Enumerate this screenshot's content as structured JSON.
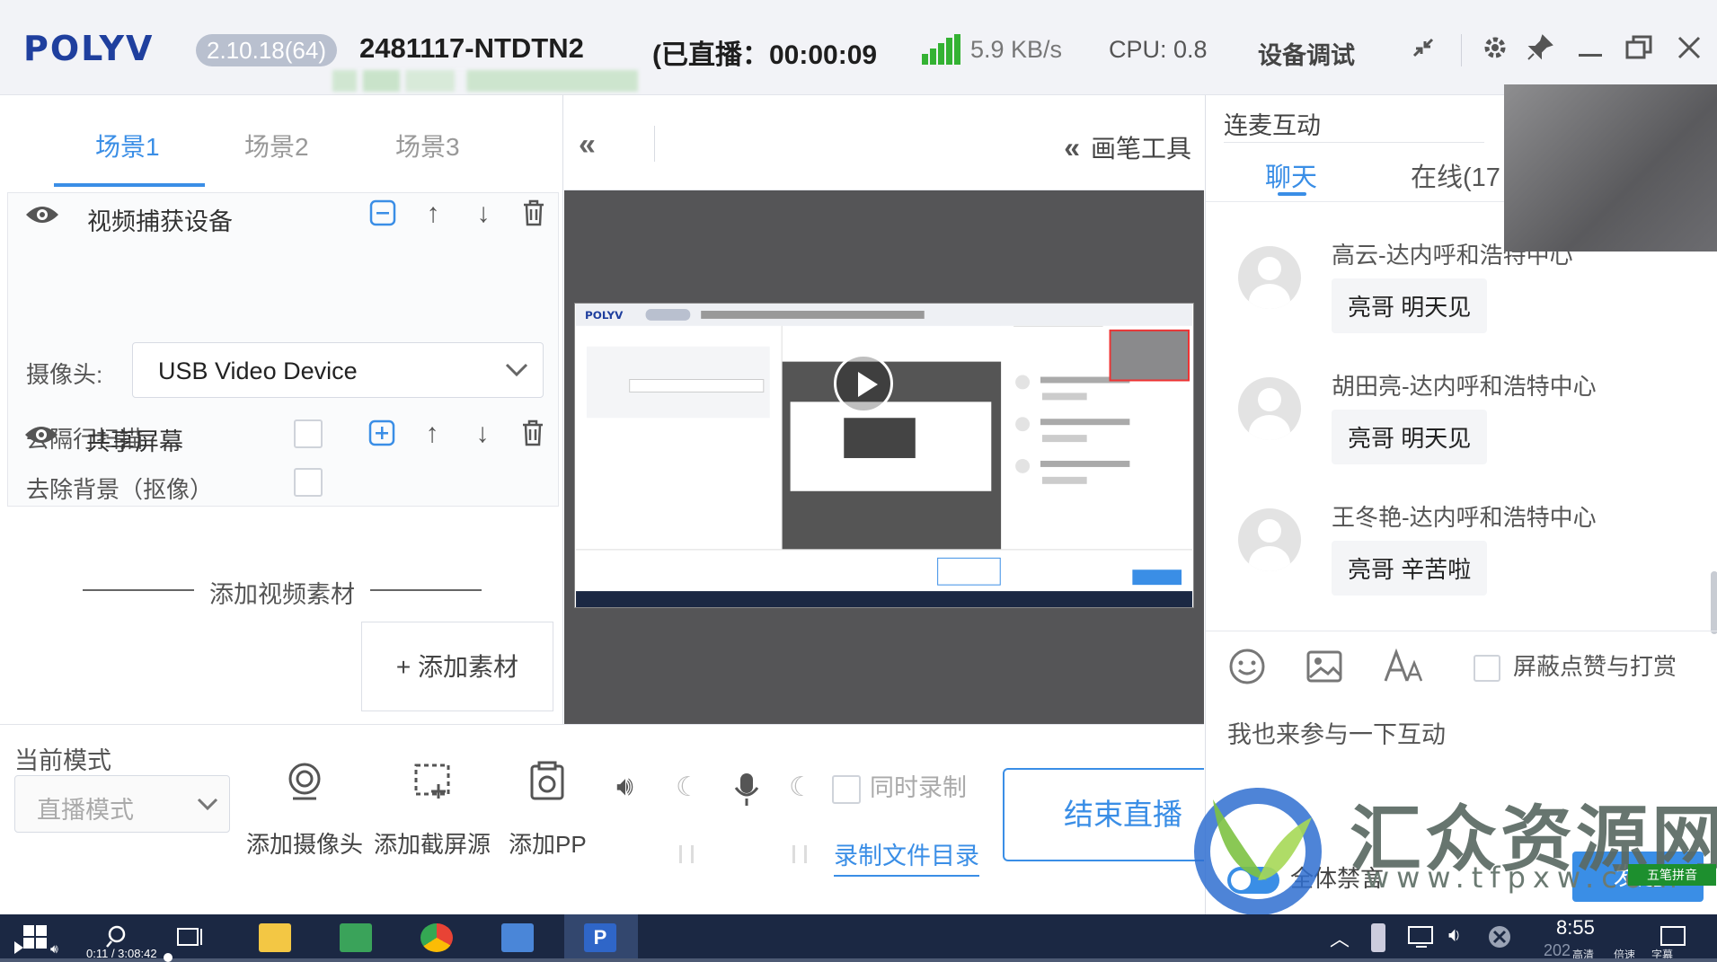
{
  "titlebar": {
    "logo": "POLYV",
    "version": "2.10.18(64)",
    "room_id": "2481117-NTDTN2",
    "live_status": "(已直播：00:00:09",
    "speed": "5.9 KB/s",
    "cpu": "CPU: 0.8",
    "device_test": "设备调试"
  },
  "scenes": {
    "tabs": [
      "场景1",
      "场景2",
      "场景3"
    ],
    "active": 0
  },
  "sources": {
    "video_capture": {
      "title": "视频捕获设备",
      "camera_label": "摄像头:",
      "camera_value": "USB Video Device",
      "deinterlace_label": "去隔行扫描",
      "remove_bg_label": "去除背景（抠像）"
    },
    "share_screen": {
      "title": "共享屏幕"
    },
    "add_video_material": "添加视频素材",
    "add_material_button": "+ 添加素材"
  },
  "preview": {
    "pen_tool": "画笔工具"
  },
  "bottom": {
    "current_mode_label": "当前模式",
    "mode_value": "直播模式",
    "tools": {
      "add_camera": "添加摄像头",
      "add_capture": "添加截屏源",
      "add_ppt": "添加PP"
    },
    "sync_record": "同时录制",
    "record_dir": "录制文件目录",
    "end_live": "结束直播"
  },
  "chat": {
    "mic_title": "连麦互动",
    "tabs": [
      "聊天",
      "在线(17"
    ],
    "messages": [
      {
        "name": "高云-达内呼和浩特中心",
        "text": "亮哥  明天见"
      },
      {
        "name": "胡田亮-达内呼和浩特中心",
        "text": "亮哥  明天见"
      },
      {
        "name": "王冬艳-达内呼和浩特中心",
        "text": "亮哥 辛苦啦"
      }
    ],
    "block_likes": "屏蔽点赞与打赏",
    "input_text": "我也来参与一下互动",
    "mute_all": "全体禁言",
    "send": "发送"
  },
  "watermark": {
    "title": "汇众资源网",
    "url": "www.tfpxw.com",
    "ime": "五笔拼音"
  },
  "taskbar": {
    "time": "8:55",
    "date": "202",
    "player_time": "0:11 / 3:08:42",
    "tray_labels": [
      "高清",
      "倍速",
      "字幕"
    ]
  },
  "colors": {
    "accent": "#3a8ee6",
    "brand": "#1f3f9e",
    "signal": "#34b233",
    "taskbar": "#1b2843"
  }
}
